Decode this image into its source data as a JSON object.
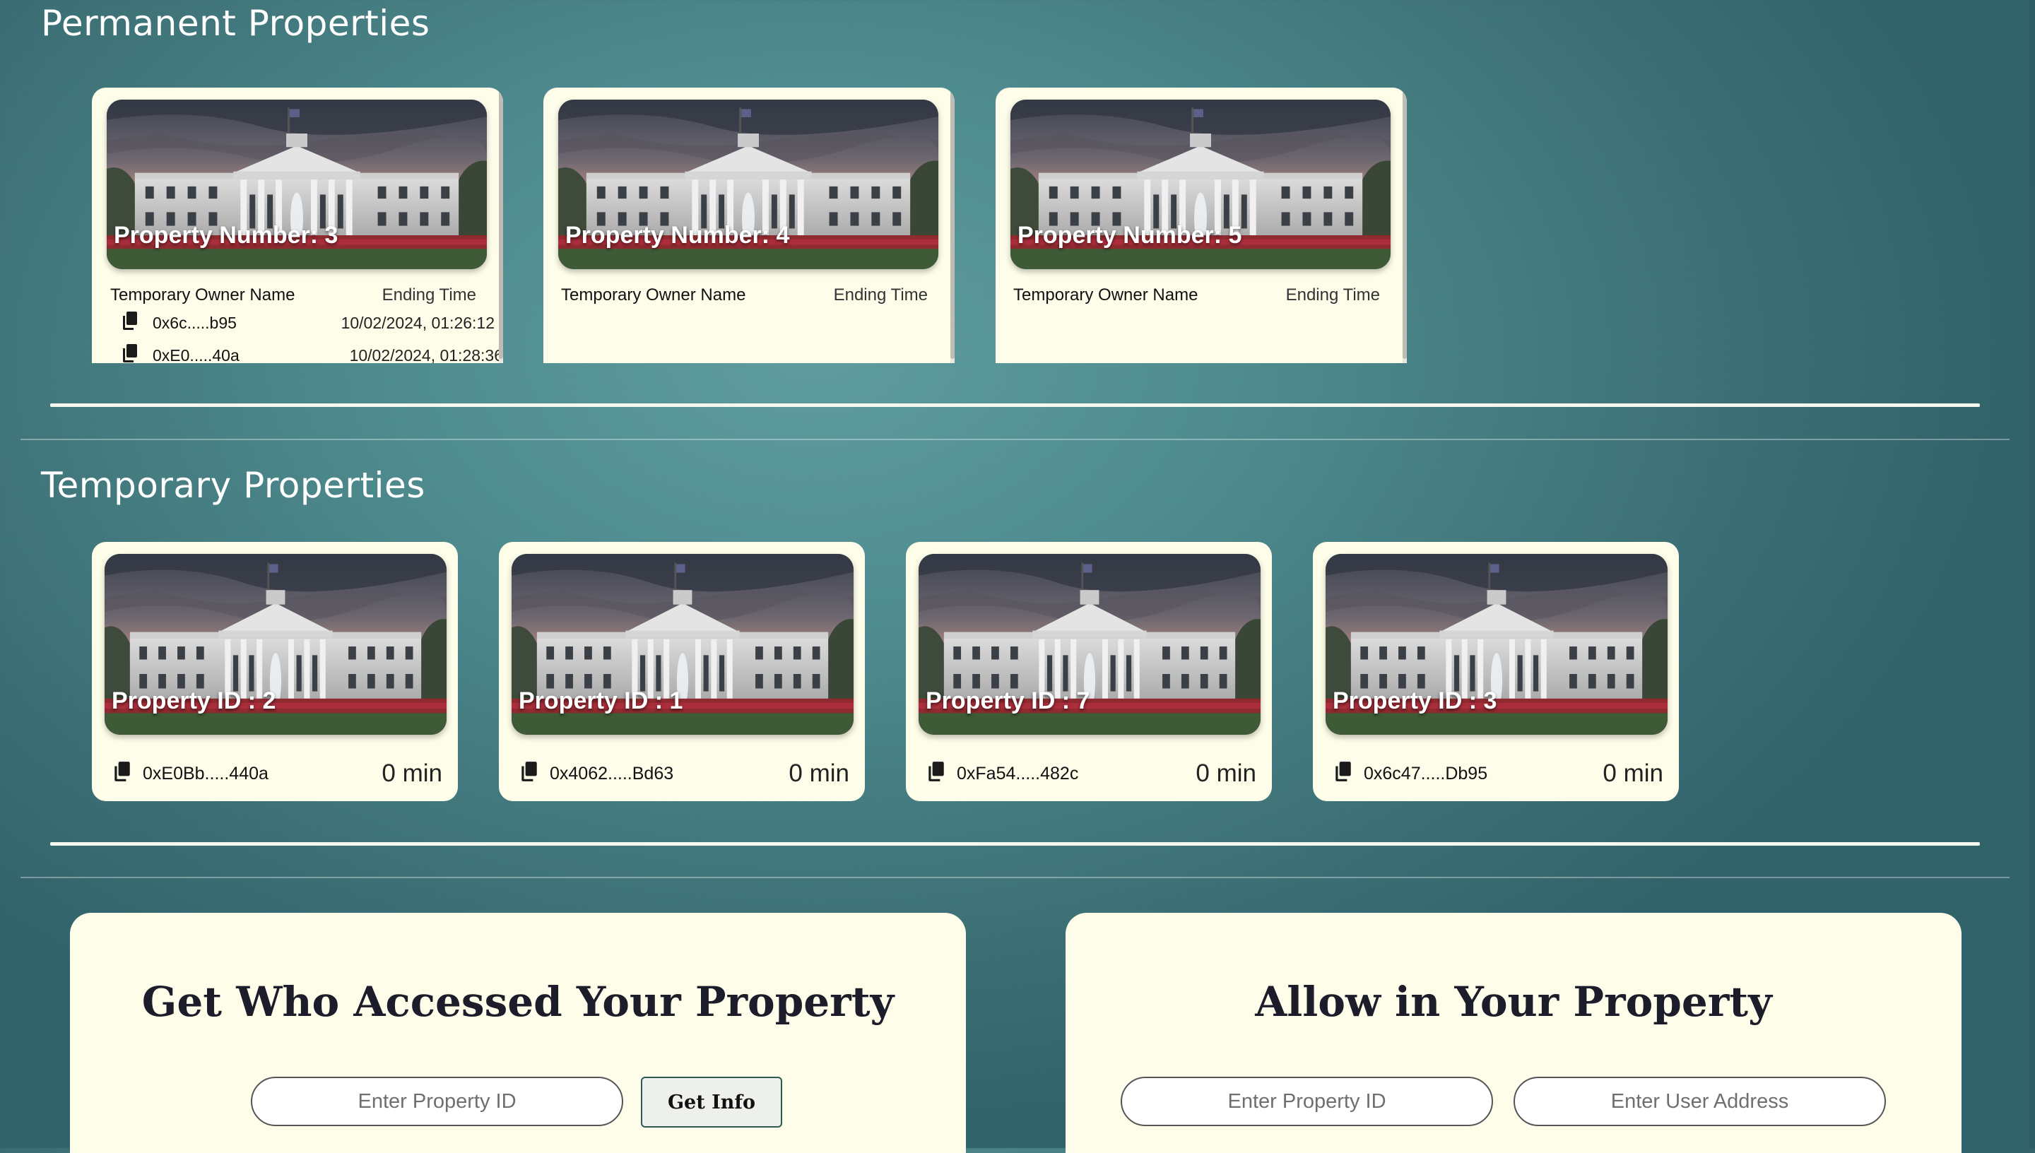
{
  "permanent": {
    "title": "Permanent Properties",
    "cards": [
      {
        "label": "Property Number: 3",
        "owner_header": "Temporary Owner Name",
        "time_header": "Ending Time",
        "rows": [
          {
            "address": "0x6c.....b95",
            "time": "10/02/2024, 01:26:12"
          },
          {
            "address": "0xE0.....40a",
            "time": "10/02/2024, 01:28:36"
          }
        ]
      },
      {
        "label": "Property Number: 4",
        "owner_header": "Temporary Owner Name",
        "time_header": "Ending Time",
        "rows": []
      },
      {
        "label": "Property Number: 5",
        "owner_header": "Temporary Owner Name",
        "time_header": "Ending Time",
        "rows": []
      }
    ]
  },
  "temporary": {
    "title": "Temporary Properties",
    "cards": [
      {
        "label": "Property ID : 2",
        "address": "0xE0Bb.....440a",
        "duration": "0 min"
      },
      {
        "label": "Property ID : 1",
        "address": "0x4062.....Bd63",
        "duration": "0 min"
      },
      {
        "label": "Property ID : 7",
        "address": "0xFa54.....482c",
        "duration": "0 min"
      },
      {
        "label": "Property ID : 3",
        "address": "0x6c47.....Db95",
        "duration": "0 min"
      }
    ]
  },
  "access_form": {
    "title": "Get Who Accessed Your Property",
    "property_id_placeholder": "Enter Property ID",
    "button_label": "Get Info"
  },
  "allow_form": {
    "title": "Allow in Your Property",
    "property_id_placeholder": "Enter Property ID",
    "user_address_placeholder": "Enter User Address"
  },
  "icons": {
    "copy": "copy-icon",
    "property_image": "white-house-photo"
  },
  "colors": {
    "card_background": "#fdfde9",
    "page_teal": "#4f8c8f"
  }
}
